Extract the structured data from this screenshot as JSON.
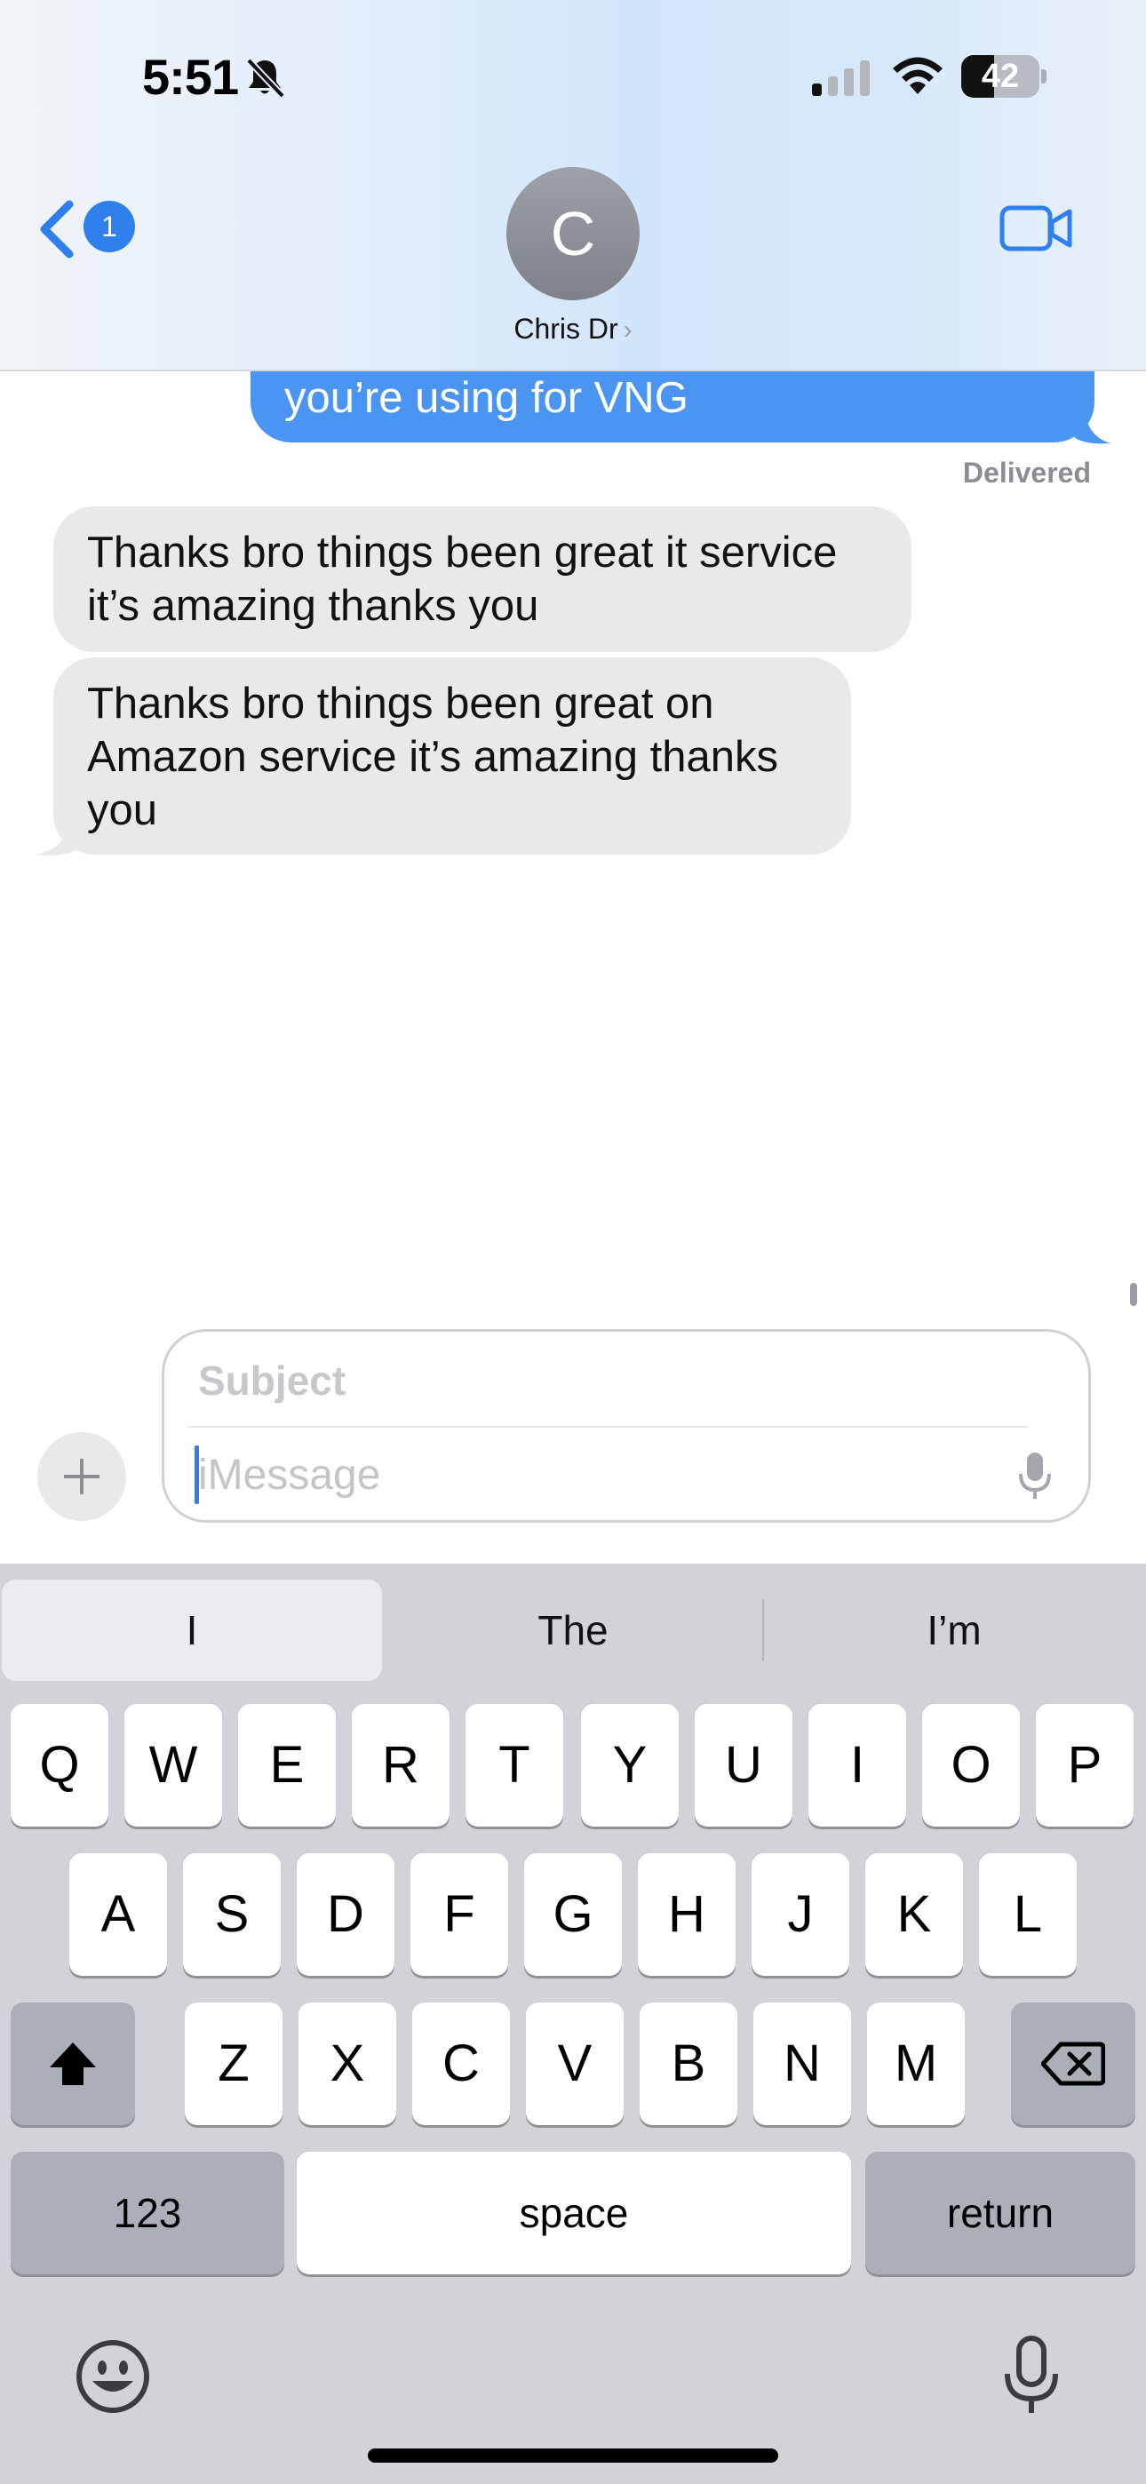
{
  "status_bar": {
    "time": "5:51",
    "battery_level": "42",
    "icons": [
      "bell-slash-icon",
      "signal-icon",
      "wifi-icon",
      "battery-icon"
    ]
  },
  "header": {
    "back_badge": "1",
    "avatar_initial": "C",
    "contact_name": "Chris Dr",
    "contact_chevron": "›",
    "icons": [
      "chevron-left-icon",
      "video-camera-icon"
    ]
  },
  "conversation": {
    "outgoing_partial": "you’re using for VNG",
    "delivered_label": "Delivered",
    "incoming": [
      "Thanks bro things been great it service it’s amazing thanks you",
      "Thanks bro things been great on Amazon service it’s amazing thanks you"
    ]
  },
  "compose": {
    "subject_placeholder": "Subject",
    "message_placeholder": "iMessage",
    "icons": [
      "plus-icon",
      "microphone-icon"
    ]
  },
  "keyboard": {
    "suggestions": [
      "I",
      "The",
      "I’m"
    ],
    "row1": [
      "Q",
      "W",
      "E",
      "R",
      "T",
      "Y",
      "U",
      "I",
      "O",
      "P"
    ],
    "row2": [
      "A",
      "S",
      "D",
      "F",
      "G",
      "H",
      "J",
      "K",
      "L"
    ],
    "row3": [
      "Z",
      "X",
      "C",
      "V",
      "B",
      "N",
      "M"
    ],
    "numbers_label": "123",
    "space_label": "space",
    "return_label": "return",
    "icons": [
      "shift-icon",
      "delete-icon",
      "emoji-icon",
      "dictation-icon"
    ]
  },
  "colors": {
    "accent": "#2f80ed",
    "outgoing_bubble": "#4a95f1",
    "incoming_bubble": "#e9e9eb",
    "keyboard_bg": "#d1d3d9"
  }
}
